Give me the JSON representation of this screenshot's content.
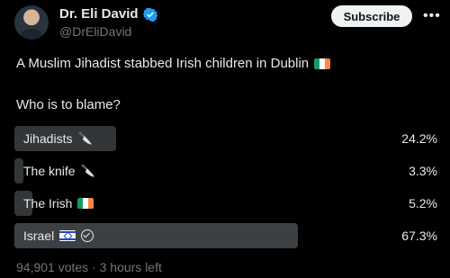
{
  "author": {
    "name": "Dr. Eli David",
    "handle": "@DrEliDavid"
  },
  "actions": {
    "subscribe_label": "Subscribe",
    "more_label": "•••"
  },
  "tweet": {
    "text": "A Muslim Jihadist stabbed Irish children in Dublin",
    "question": "Who is to blame?"
  },
  "poll": {
    "options": [
      {
        "label": "Jihadists",
        "percent": "24.2%",
        "fraction": 0.242,
        "icon": "knife-icon"
      },
      {
        "label": "The knife",
        "percent": "3.3%",
        "fraction": 0.033,
        "icon": "knife-icon"
      },
      {
        "label": "The Irish",
        "percent": "5.2%",
        "fraction": 0.052,
        "icon": "irish-flag-icon"
      },
      {
        "label": "Israel",
        "percent": "67.3%",
        "fraction": 0.673,
        "icon": "israel-flag-icon",
        "selected": true
      }
    ],
    "footer": "94,901 votes · 3 hours left"
  },
  "colors": {
    "background": "#000000",
    "bar": "#333639",
    "verified": "#1d9bf0"
  }
}
